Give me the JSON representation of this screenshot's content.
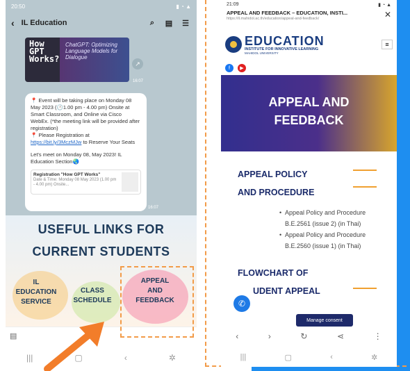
{
  "left_phone": {
    "status_time": "20:50",
    "chat_title": "IL Education",
    "image_card": {
      "title_lines": [
        "How",
        "GPT",
        "Works?"
      ],
      "subtitle": "ChatGPT: Optimizing Language Models for Dialogue",
      "time": "16:07"
    },
    "message": {
      "line1": "📍 Event will be taking place on Monday 08 May 2023 (🕐1.00 pm - 4.00 pm) Onsite at Smart Classroom, and Online via Cisco WebEx. (*the meeting link will be provided after registration)",
      "line2_prefix": "📍 Please Registration at ",
      "line2_link": "https://bit.ly/3MczMJw",
      "line2_suffix": " to Reserve Your Seats",
      "line3": "Let's meet on Monday 08, May 2023! IL Education Section🌏",
      "reg_title": "Registration \"How GPT Works\"",
      "reg_sub": "Date & Time: Monday 08 May 2023 (1.00 pm - 4.00 pm) Onsite...",
      "time": "16:07"
    },
    "banner": {
      "heading1": "USEFUL LINKS FOR",
      "heading2": "CURRENT STUDENTS",
      "link1": [
        "IL",
        "EDUCATION",
        "SERVICE"
      ],
      "link2": [
        "CLASS",
        "SCHEDULE"
      ],
      "link3": [
        "APPEAL",
        "AND",
        "FEEDBACK"
      ]
    }
  },
  "right_phone": {
    "status_time": "21:09",
    "page_title": "APPEAL AND FEEDBACK – EDUCATION, INSTI...",
    "url": "https://il.mahidol.ac.th/education/appeal-and-feedback/",
    "brand_name": "EDUCATION",
    "brand_sub": "INSTITUTE FOR INNOVATIVE LEARNING",
    "brand_uni": "MAHIDOL UNIVERSITY",
    "hero_line1": "APPEAL AND",
    "hero_line2": "FEEDBACK",
    "section1_line1": "APPEAL POLICY",
    "section1_line2": "AND PROCEDURE",
    "items": [
      "Appeal Policy and Procedure B.E.2561 (issue 2) (in Thai)",
      "Appeal Policy and Procedure B.E.2560 (issue 1) (in Thai)"
    ],
    "section2_line1": "FLOWCHART OF",
    "section2_line2": "UDENT APPEAL",
    "manage_consent": "Manage consent"
  }
}
